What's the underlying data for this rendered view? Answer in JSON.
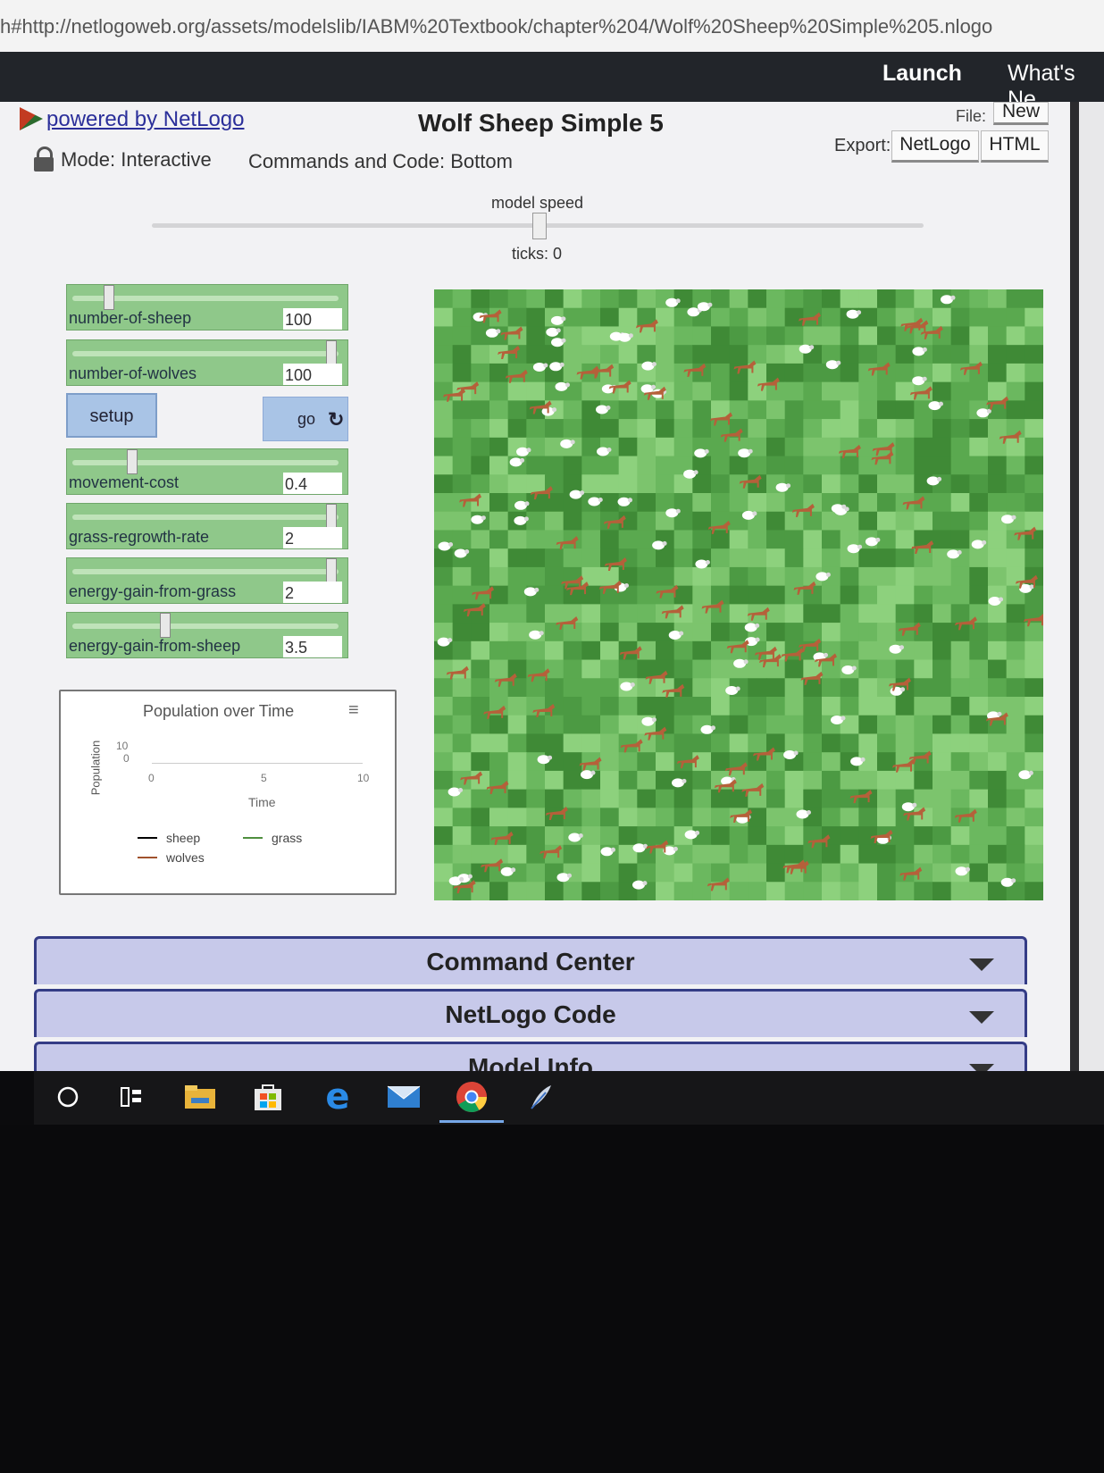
{
  "browser": {
    "url": "h#http://netlogoweb.org/assets/modelslib/IABM%20Textbook/chapter%204/Wolf%20Sheep%20Simple%205.nlogo"
  },
  "topnav": {
    "launch": "Launch",
    "whats_new": "What's Ne"
  },
  "header": {
    "powered_by": "powered by NetLogo",
    "title": "Wolf Sheep Simple 5",
    "file_label": "File:",
    "new_button": "New",
    "export_label": "Export:",
    "export_netlogo": "NetLogo",
    "export_html": "HTML",
    "mode": "Mode: Interactive",
    "commands_position": "Commands and Code: Bottom"
  },
  "speed": {
    "label": "model speed",
    "ticks": "ticks: 0"
  },
  "widgets": {
    "sliders": [
      {
        "name": "number-of-sheep",
        "value": "100",
        "fraction": 0.13
      },
      {
        "name": "number-of-wolves",
        "value": "100",
        "fraction": 1.0
      },
      {
        "name": "movement-cost",
        "value": "0.4",
        "fraction": 0.22
      },
      {
        "name": "grass-regrowth-rate",
        "value": "2",
        "fraction": 1.0
      },
      {
        "name": "energy-gain-from-grass",
        "value": "2",
        "fraction": 1.0
      },
      {
        "name": "energy-gain-from-sheep",
        "value": "3.5",
        "fraction": 0.35
      }
    ],
    "setup_label": "setup",
    "go_label": "go",
    "go_icon": "refresh-icon"
  },
  "plot": {
    "title": "Population over Time",
    "ylabel": "Population",
    "xlabel": "Time",
    "yticks": [
      "10",
      "0"
    ],
    "xticks": [
      "0",
      "5",
      "10"
    ],
    "legend": {
      "sheep": "sheep",
      "grass": "grass",
      "wolves": "wolves"
    },
    "colors": {
      "sheep": "#000000",
      "grass": "#4f8f3f",
      "wolves": "#a0522d"
    }
  },
  "world": {
    "grass_colors": [
      "#3f8a36",
      "#4c9a43",
      "#5aa94f",
      "#6bb85f",
      "#7cc46d",
      "#8dd17d"
    ],
    "sheep_color": "#ffffff",
    "wolf_color": "#b5603a"
  },
  "accordion": {
    "command_center": "Command Center",
    "netlogo_code": "NetLogo Code",
    "model_info": "Model Info"
  },
  "taskbar": {
    "icons": [
      "cortana-search-icon",
      "task-view-icon",
      "file-explorer-icon",
      "store-icon",
      "edge-icon",
      "mail-icon",
      "chrome-icon",
      "feather-app-icon"
    ]
  }
}
